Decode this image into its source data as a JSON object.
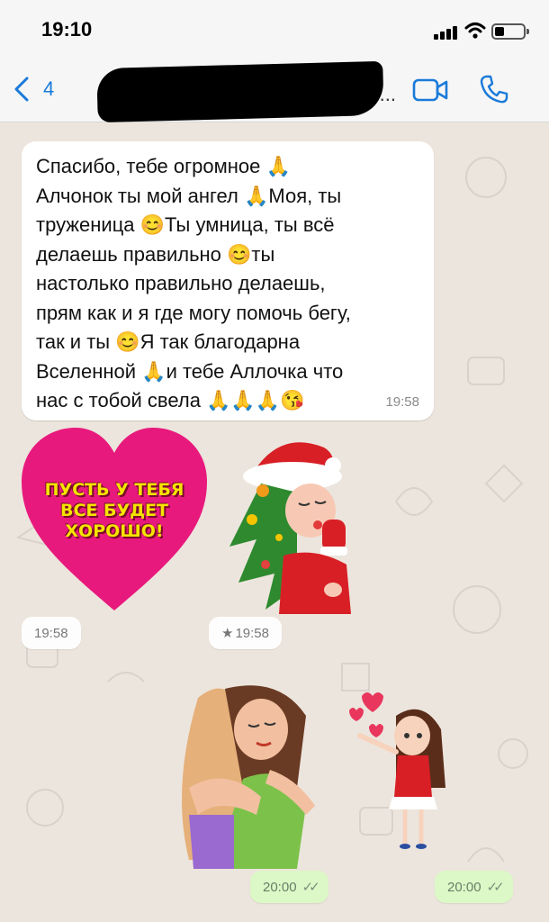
{
  "status_bar": {
    "time": "19:10"
  },
  "nav": {
    "back_count": "4",
    "contact_name_suffix": "..."
  },
  "messages": {
    "incoming_text": "Спасибо, тебе огромное 🙏\nАлчонок ты мой ангел 🙏Моя, ты\nтруженица 😊Ты умница, ты всё\nделаешь правильно 😊ты\nнастолько правильно делаешь,\nпрям как и я где могу помочь бегу,\nтак и ты 😊Я так благодарна\nВселенной 🙏и тебе Аллочка что\nнас с тобой свела 🙏🙏🙏😘",
    "incoming_time": "19:58",
    "heart_sticker_text": [
      "ПУСТЬ У ТЕБЯ",
      "ВСЕ БУДЕТ",
      "ХОРОШО!"
    ],
    "heart_sticker_time": "19:58",
    "girl_sticker_star": "★",
    "girl_sticker_time": "19:58",
    "hug_sticker_time": "20:00",
    "kiss_sticker_time": "20:00"
  },
  "colors": {
    "accent": "#1a7ad9",
    "heart": "#e8197d",
    "heart_text": "#f5e400",
    "outgoing_bubble": "#dcf8c6"
  }
}
